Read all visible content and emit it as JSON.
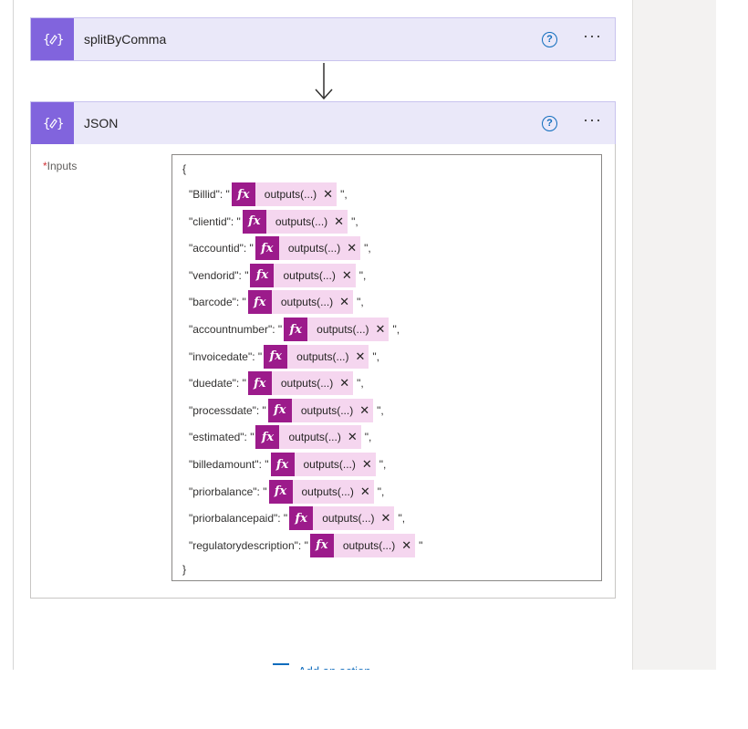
{
  "cards": {
    "split": {
      "title": "splitByComma",
      "icon": "{⊘}"
    },
    "json": {
      "title": "JSON",
      "icon": "{⊘}"
    }
  },
  "json_action": {
    "required_mark": "*",
    "inputs_label": "Inputs",
    "open_brace": "{",
    "close_brace": "}",
    "token_label": "outputs(...)",
    "fields": [
      {
        "key": "\"Billid\": \"",
        "tail": "\","
      },
      {
        "key": "\"clientid\": \"",
        "tail": "\","
      },
      {
        "key": "\"accountid\": \"",
        "tail": "\","
      },
      {
        "key": "\"vendorid\": \"",
        "tail": "\","
      },
      {
        "key": "\"barcode\": \"",
        "tail": "\","
      },
      {
        "key": "\"accountnumber\": \"",
        "tail": "\","
      },
      {
        "key": "\"invoicedate\": \"",
        "tail": "\","
      },
      {
        "key": "\"duedate\": \"",
        "tail": "\","
      },
      {
        "key": "\"processdate\": \"",
        "tail": "\","
      },
      {
        "key": "\"estimated\": \"",
        "tail": "\","
      },
      {
        "key": "\"billedamount\": \"",
        "tail": "\","
      },
      {
        "key": "\"priorbalance\": \"",
        "tail": "\","
      },
      {
        "key": "\"priorbalancepaid\": \"",
        "tail": "\","
      },
      {
        "key": "\"regulatorydescription\": \"",
        "tail": "\""
      }
    ]
  },
  "footer": {
    "add_action_label": "Add an action"
  },
  "icons": {
    "action": "data-operation-icon",
    "help": "help-icon",
    "more": "more-options-icon",
    "fx": "expression-icon",
    "remove": "close-icon"
  },
  "colors": {
    "action_accent": "#8164dd",
    "card_header_bg": "#eae8f9",
    "expression_token": "#9c1b8b",
    "token_bg": "#f5d6ef",
    "link": "#0f6cbd"
  }
}
